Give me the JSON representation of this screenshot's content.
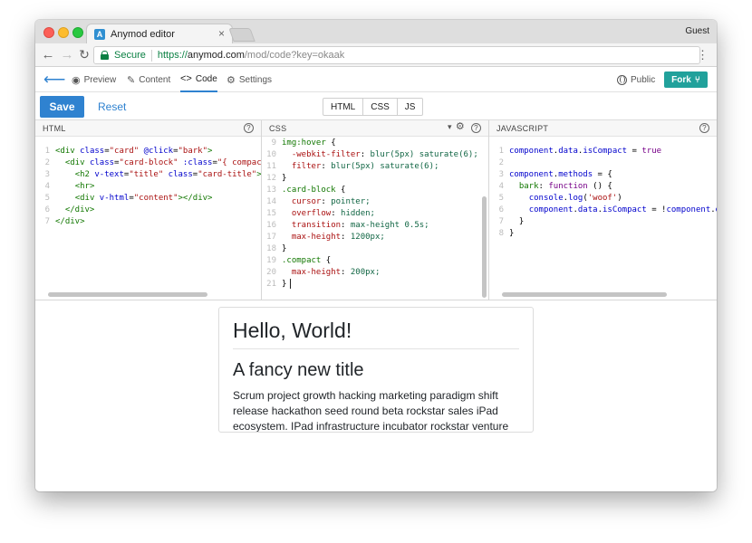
{
  "browser": {
    "tab_title": "Anymod editor",
    "tab_favicon_letter": "A",
    "tab_close": "×",
    "profile": "Guest",
    "secure_label": "Secure",
    "url_scheme": "https://",
    "url_host": "anymod.com",
    "url_path": "/mod/code?key=okaak"
  },
  "appnav": {
    "preview": "Preview",
    "content": "Content",
    "code": "Code",
    "settings": "Settings",
    "public": "Public",
    "fork": "Fork"
  },
  "toolbar": {
    "save": "Save",
    "reset": "Reset",
    "lang_tabs": [
      "HTML",
      "CSS",
      "JS"
    ]
  },
  "panels": {
    "html_title": "HTML",
    "css_title": "CSS",
    "js_title": "JAVASCRIPT"
  },
  "preview": {
    "heading": "Hello, World!",
    "title": "A fancy new title",
    "body": "Scrum project growth hacking marketing paradigm shift release hackathon seed round beta rockstar sales iPad ecosystem. IPad infrastructure incubator rockstar venture"
  },
  "colors": {
    "accent": "#2f82d0",
    "fork": "#21a19b",
    "secure": "#0b8043"
  }
}
